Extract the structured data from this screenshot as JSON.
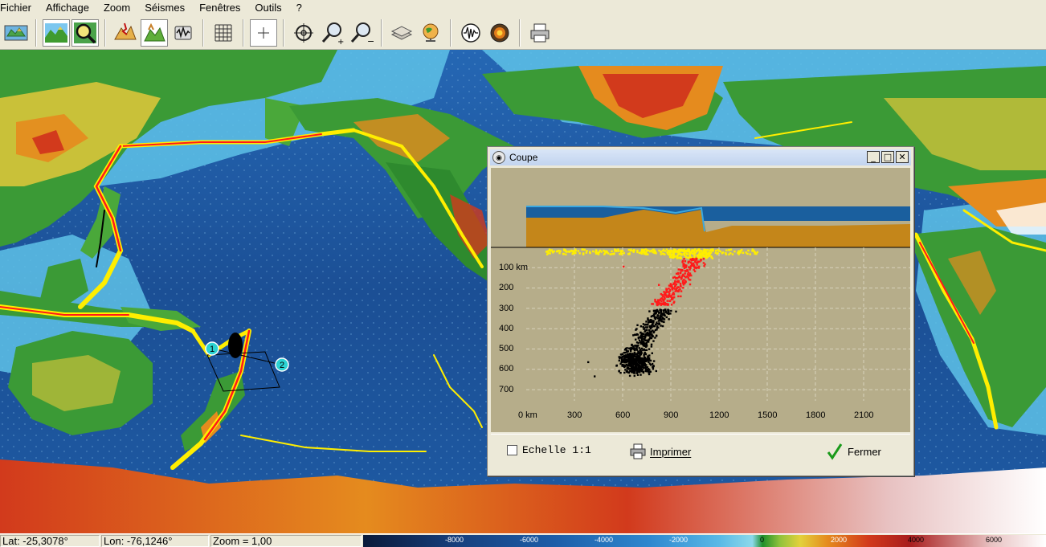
{
  "menu": [
    "Fichier",
    "Affichage",
    "Zoom",
    "Séismes",
    "Fenêtres",
    "Outils",
    "?"
  ],
  "toolbar_icons": [
    "map-icon",
    "landscape-icon",
    "magnifier-map-icon",
    "earthquake-icon",
    "relief-icon",
    "seismograph-icon",
    "grid-icon",
    "crosshair-icon",
    "target-icon",
    "zoom-in-icon",
    "zoom-out-icon",
    "layers-icon",
    "globe-icon",
    "waveform-icon",
    "earth-core-icon",
    "printer-icon"
  ],
  "map": {
    "markers": [
      {
        "label": "1"
      },
      {
        "label": "2"
      }
    ]
  },
  "dialog": {
    "title": "Coupe",
    "min_label": "_",
    "max_label": "□",
    "close_label": "✕",
    "depth_labels": [
      "100 km",
      "200",
      "300",
      "400",
      "500",
      "600",
      "700"
    ],
    "distance_labels": [
      "0 km",
      "300",
      "600",
      "900",
      "1200",
      "1500",
      "1800",
      "2100"
    ],
    "scale_checkbox_label": "Echelle 1:1",
    "scale_checked": false,
    "print_label": "Imprimer",
    "close_button_label": "Fermer"
  },
  "status": {
    "lat": "Lat: -25,3078°",
    "lon": "Lon: -76,1246°",
    "zoom": "Zoom = 1,00"
  },
  "color_scale": {
    "labels": [
      "-8000",
      "-6000",
      "-4000",
      "-2000",
      "0",
      "2000",
      "4000",
      "6000"
    ]
  },
  "colors": {
    "ocean_deep": "#1a4f94",
    "ocean_shallow": "#5ec2e8",
    "land_low": "#2d9b33",
    "land_mid": "#e3c83a",
    "land_high": "#d23a1c",
    "quake_shallow": "#ffee00",
    "quake_intermediate": "#ff1a1a",
    "quake_deep": "#000000",
    "plot_bg": "#b6ad8a"
  }
}
